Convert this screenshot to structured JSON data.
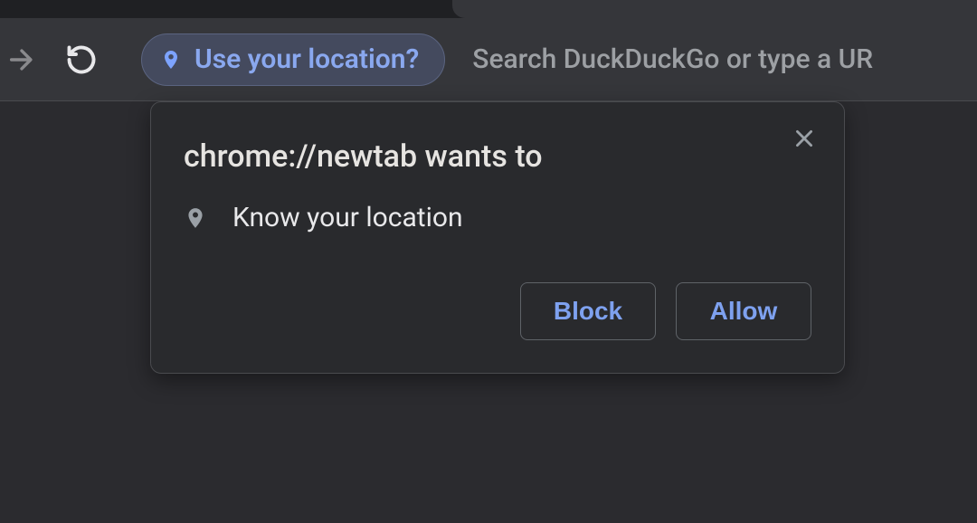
{
  "toolbar": {
    "location_chip_label": "Use your location?",
    "omnibox_placeholder": "Search DuckDuckGo or type a UR"
  },
  "dialog": {
    "title": "chrome://newtab wants to",
    "permission_label": "Know your location",
    "block_label": "Block",
    "allow_label": "Allow"
  }
}
